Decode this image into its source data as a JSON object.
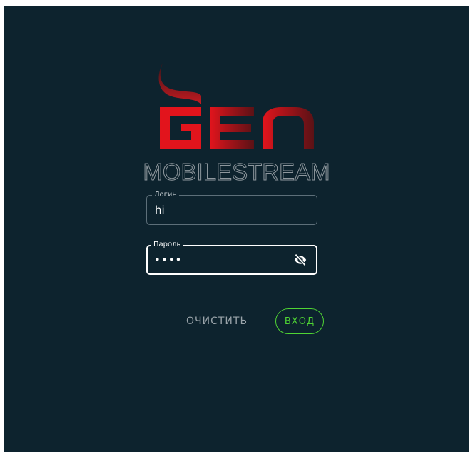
{
  "brand": {
    "logo_text": "GEN",
    "product_name": "MOBILESTREAM"
  },
  "login": {
    "label": "Логин",
    "value": "hi"
  },
  "password": {
    "label": "Пароль",
    "masked_value": "••••",
    "visibility_icon": "eye-off-icon"
  },
  "actions": {
    "clear_label": "ОЧИСТИТЬ",
    "enter_label": "ВХОД"
  },
  "colors": {
    "background": "#0d232e",
    "brand_red": "#e2141c",
    "accent_green": "#4fd434",
    "muted_text": "#9aa4aa"
  }
}
